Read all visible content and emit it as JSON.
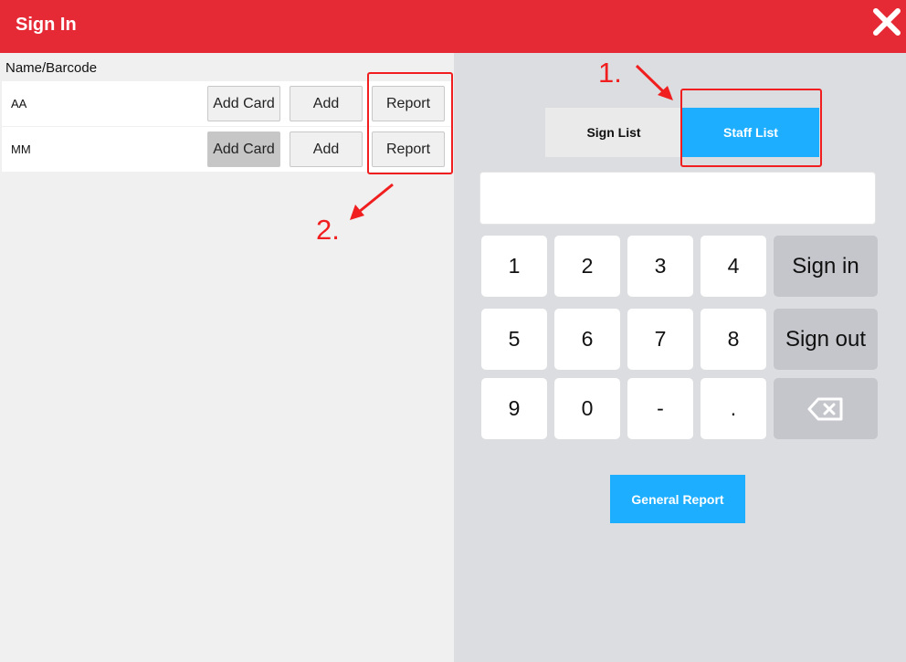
{
  "window": {
    "title": "Sign In",
    "close_icon": "close-icon"
  },
  "list": {
    "column_header": "Name/Barcode",
    "rows": [
      {
        "name": "AA",
        "add_card": "Add Card",
        "add": "Add",
        "report": "Report"
      },
      {
        "name": "MM",
        "add_card": "Add Card",
        "add": "Add",
        "report": "Report"
      }
    ]
  },
  "tabs": [
    {
      "label": "Sign List",
      "active": false
    },
    {
      "label": "Staff List",
      "active": true
    }
  ],
  "input": {
    "value": ""
  },
  "keypad": {
    "keys": [
      "1",
      "2",
      "3",
      "4",
      "5",
      "6",
      "7",
      "8",
      "9",
      "0",
      "-",
      "."
    ],
    "sign_in": "Sign in",
    "sign_out": "Sign out",
    "backspace_icon": "backspace-icon"
  },
  "general_report": "General Report",
  "annotations": {
    "step1": "1.",
    "step2": "2."
  },
  "colors": {
    "header_red": "#e52a36",
    "accent_blue": "#1eaeff",
    "annotation_red": "#f01e1e"
  }
}
